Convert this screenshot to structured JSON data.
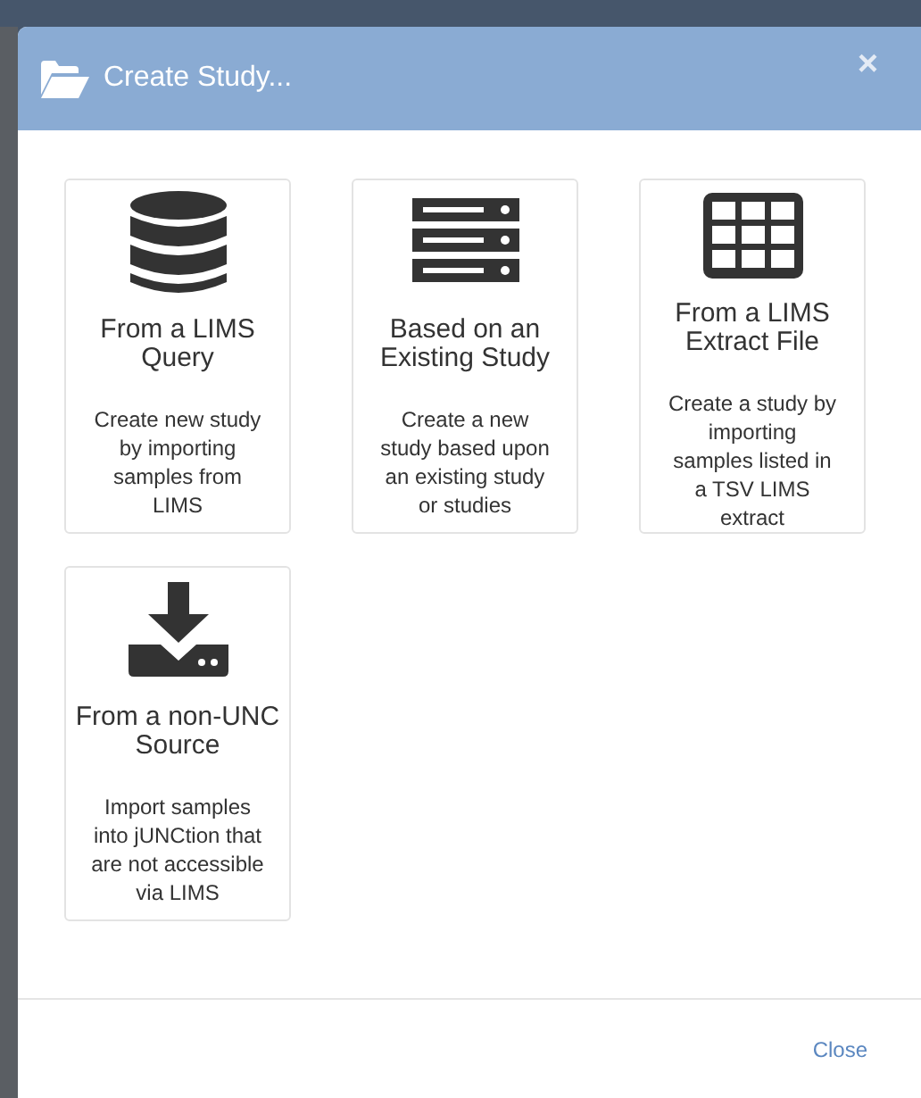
{
  "dialog": {
    "title": "Create Study...",
    "close_symbol": "×"
  },
  "options": [
    {
      "title": "From a LIMS Query",
      "description": "Create new study by importing samples from LIMS"
    },
    {
      "title": "Based on an Existing Study",
      "description": "Create a new study based upon an existing study or studies"
    },
    {
      "title": "From a LIMS Extract File",
      "description": "Create a study by importing samples listed in a TSV LIMS extract"
    },
    {
      "title": "From a non-UNC Source",
      "description": "Import samples into jUNCtion that are not accessible via LIMS"
    }
  ],
  "footer": {
    "close_button": "Close"
  }
}
